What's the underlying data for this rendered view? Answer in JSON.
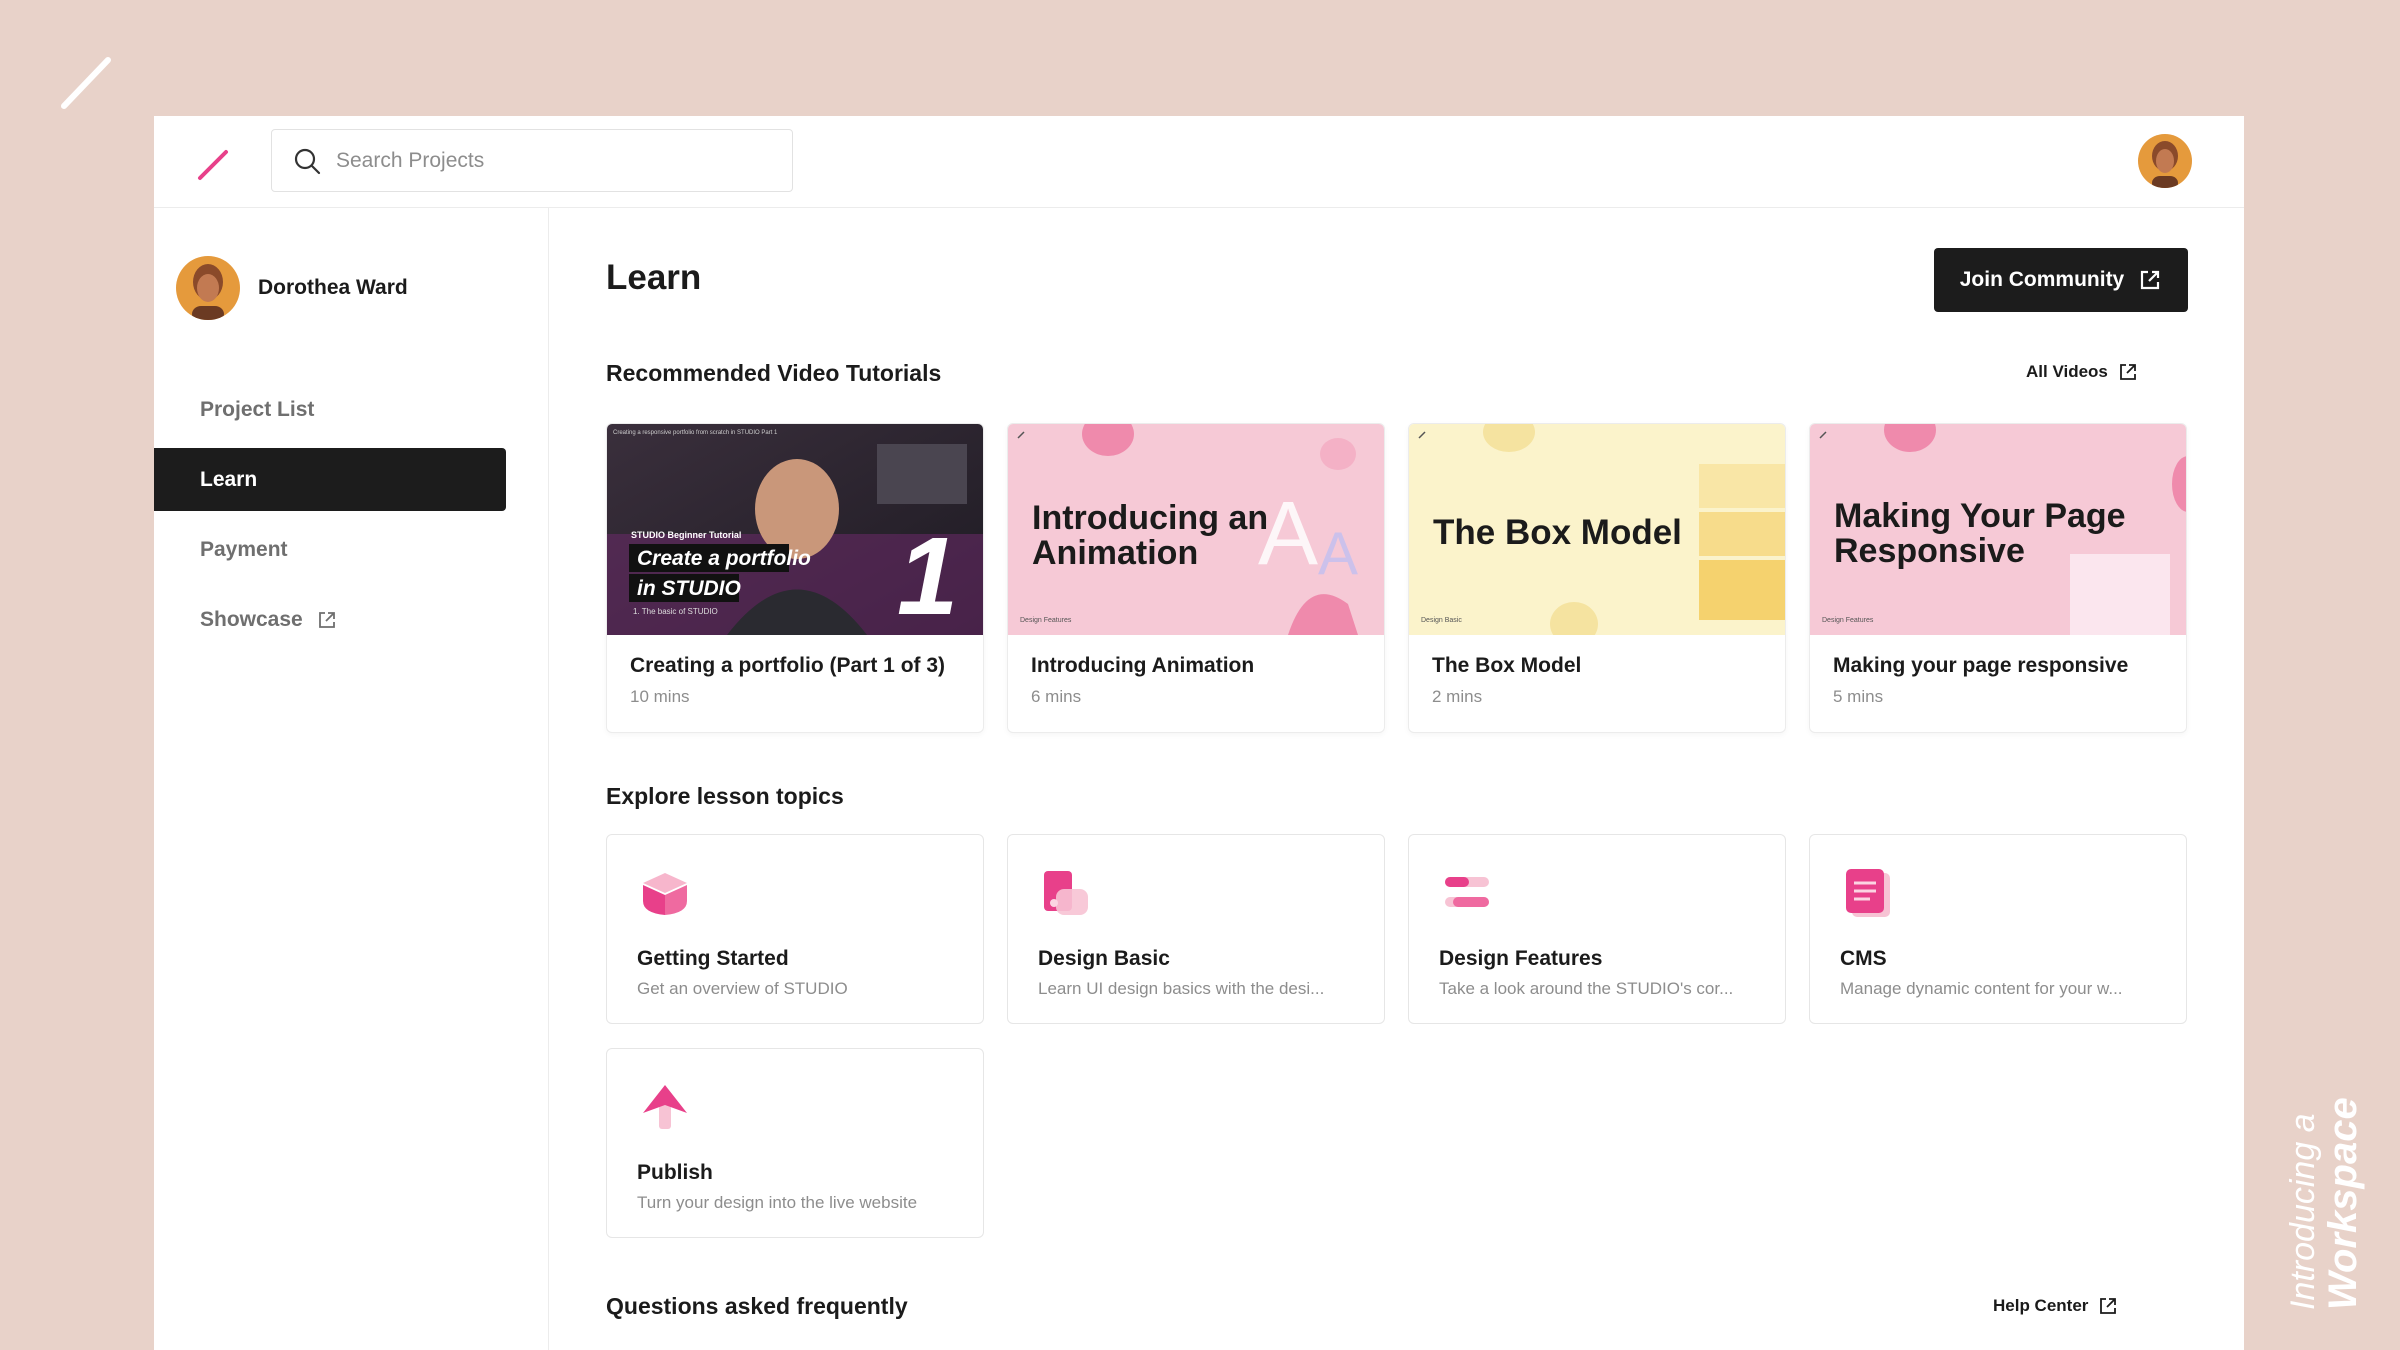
{
  "colors": {
    "accent": "#e8408a",
    "dark": "#1c1c1c",
    "background": "#e8d2c9"
  },
  "side_tag": {
    "line1": "Introducing a",
    "line2": "Workspace"
  },
  "search": {
    "placeholder": "Search Projects",
    "value": ""
  },
  "user": {
    "name": "Dorothea Ward"
  },
  "nav": [
    {
      "label": "Project List"
    },
    {
      "label": "Learn"
    },
    {
      "label": "Payment"
    },
    {
      "label": "Showcase"
    }
  ],
  "page": {
    "title": "Learn",
    "join_label": "Join Community"
  },
  "videos_section": {
    "title": "Recommended Video Tutorials",
    "link": "All Videos"
  },
  "videos": [
    {
      "title": "Creating a portfolio (Part 1 of 3)",
      "duration": "10 mins",
      "thumb": {
        "caption_top": "Creating a responsive portfolio from scratch in STUDIO Part 1",
        "series": "STUDIO Beginner Tutorial",
        "line1": "Create a portfolio",
        "line2": "in STUDIO",
        "sub": "1. The basic of STUDIO",
        "number": "1"
      }
    },
    {
      "title": "Introducing Animation",
      "duration": "6 mins",
      "thumb": {
        "line1": "Introducing an",
        "line2": "Animation",
        "tag": "Design Features"
      }
    },
    {
      "title": "The Box Model",
      "duration": "2 mins",
      "thumb": {
        "line1": "The Box Model",
        "tag": "Design Basic"
      }
    },
    {
      "title": "Making your page responsive",
      "duration": "5 mins",
      "thumb": {
        "line1": "Making Your Page",
        "line2": "Responsive",
        "tag": "Design Features"
      }
    }
  ],
  "topics_section": {
    "title": "Explore lesson topics"
  },
  "topics": [
    {
      "name": "Getting Started",
      "desc": "Get an overview of STUDIO",
      "icon": "box-icon"
    },
    {
      "name": "Design Basic",
      "desc": "Learn UI design basics with the desi...",
      "icon": "design-layers-icon"
    },
    {
      "name": "Design Features",
      "desc": "Take a look around the STUDIO's cor...",
      "icon": "toggles-icon"
    },
    {
      "name": "CMS",
      "desc": "Manage dynamic content for your w...",
      "icon": "document-icon"
    },
    {
      "name": "Publish",
      "desc": "Turn your design into the live website",
      "icon": "upload-arrow-icon"
    }
  ],
  "faq_section": {
    "title": "Questions asked frequently",
    "link": "Help Center"
  }
}
